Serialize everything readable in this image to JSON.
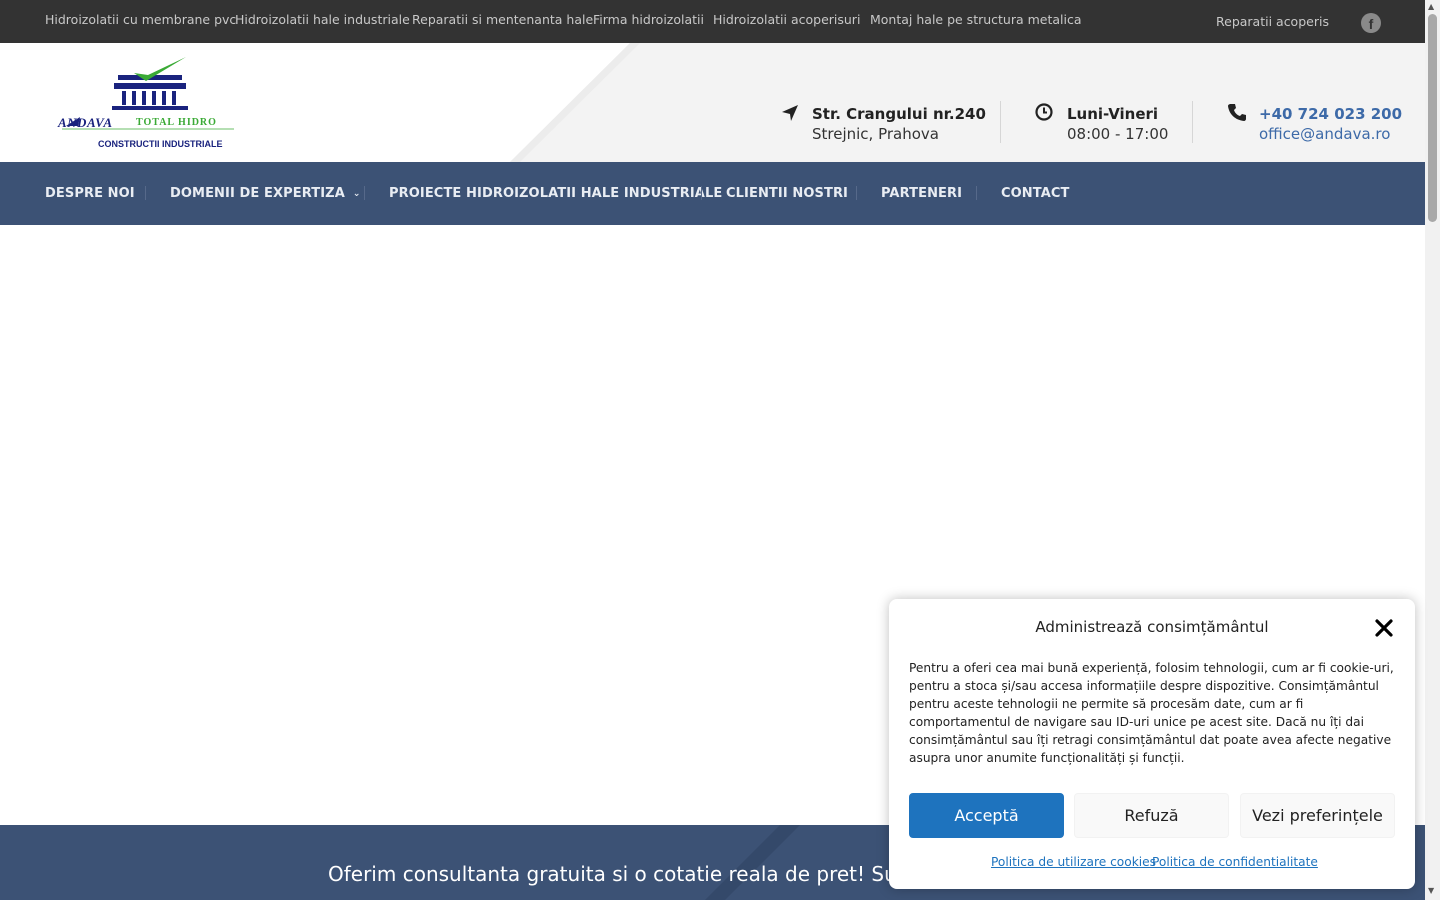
{
  "topbar": {
    "links": [
      "Hidroizolatii cu membrane pvc",
      "Hidroizolatii hale industriale",
      "Reparatii si mentenanta hale",
      "Firma hidroizolatii",
      "Hidroizolatii acoperisuri",
      "Montaj hale pe structura metalica",
      "Reparatii acoperis"
    ],
    "social_icon": "facebook-icon"
  },
  "logo": {
    "brand_main": "ANDAVA",
    "brand_secondary": "TOTAL HIDRO",
    "tagline": "CONSTRUCTII INDUSTRIALE"
  },
  "header": {
    "address": {
      "icon": "location-arrow-icon",
      "line1": "Str. Crangului nr.240",
      "line2": "Strejnic, Prahova"
    },
    "hours": {
      "icon": "clock-icon",
      "line1": "Luni-Vineri",
      "line2": "08:00 - 17:00"
    },
    "contact": {
      "icon": "phone-icon",
      "phone": "+40 724 023 200",
      "email": "office@andava.ro"
    }
  },
  "nav": {
    "items": [
      "DESPRE NOI",
      "DOMENII DE EXPERTIZA",
      "PROIECTE HIDROIZOLATII HALE INDUSTRIALE",
      "CLIENTII NOSTRI",
      "PARTENERI",
      "CONTACT"
    ]
  },
  "band": {
    "text": "Oferim consultanta gratuita si o cotatie reala de pret! Sunteti in"
  },
  "consent": {
    "title": "Administrează consimțământul",
    "body": "Pentru a oferi cea mai bună experiență, folosim tehnologii, cum ar fi cookie-uri, pentru a stoca și/sau accesa informațiile despre dispozitive. Consimțământul pentru aceste tehnologii ne permite să procesăm date, cum ar fi comportamentul de navigare sau ID-uri unice pe acest site. Dacă nu îți dai consimțământul sau îți retragi consimțământul dat poate avea afecte negative asupra unor anumite funcționalități și funcții.",
    "accept": "Acceptă",
    "deny": "Refuză",
    "preferences": "Vezi preferințele",
    "cookie_policy": "Politica de utilizare cookies",
    "privacy_policy": "Politica de confidentialitate"
  },
  "colors": {
    "topbar": "#333333",
    "nav": "#3c5275",
    "accent": "#1e73be",
    "link": "#3d6aa8"
  }
}
